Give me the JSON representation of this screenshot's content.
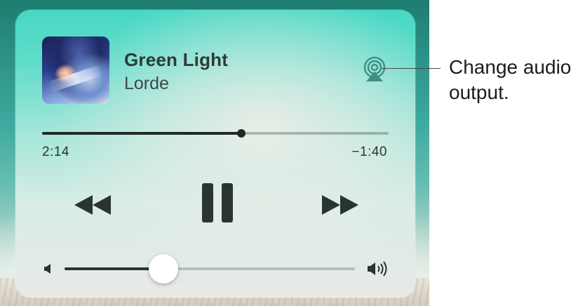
{
  "track": {
    "title": "Green Light",
    "artist": "Lorde",
    "elapsed": "2:14",
    "remaining": "−1:40",
    "progress_fraction": 0.575
  },
  "volume": {
    "level_fraction": 0.34
  },
  "icons": {
    "airplay": "airplay-icon",
    "rewind": "rewind-icon",
    "pause": "pause-icon",
    "fast_forward": "fast-forward-icon",
    "volume_low": "speaker-low-icon",
    "volume_high": "speaker-high-icon"
  },
  "callout": {
    "text": "Change audio output."
  },
  "colors": {
    "panel_top": "#47d8c4",
    "panel_bottom": "#e9eae6",
    "controls": "#2a3431",
    "airplay_icon": "#3f8f82"
  }
}
